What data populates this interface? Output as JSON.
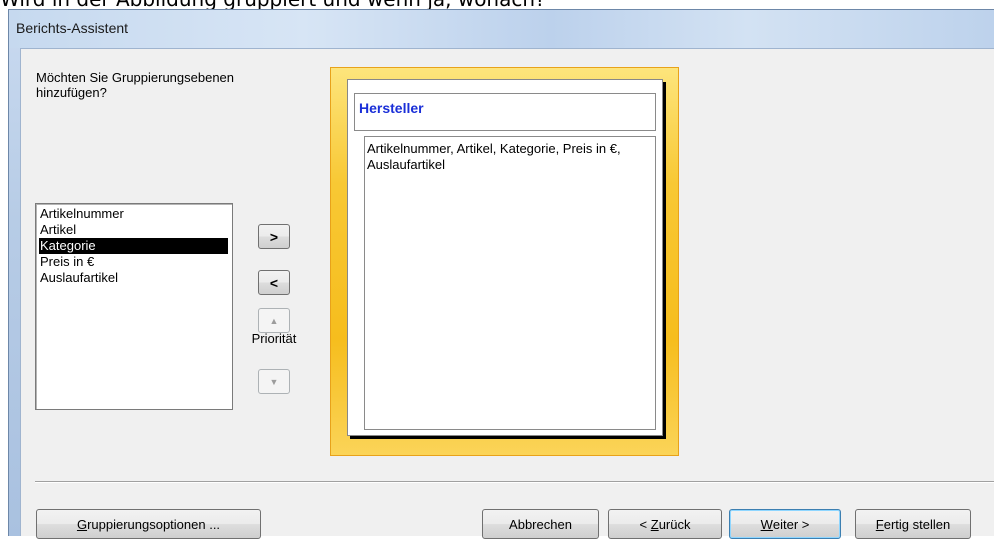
{
  "question": "Wird in der Abbildung gruppiert und wenn ja, wonach?",
  "window": {
    "title": "Berichts-Assistent"
  },
  "prompt": {
    "text": "Möchten Sie Gruppierungsebenen hinzufügen?"
  },
  "fields": {
    "items": [
      {
        "label": "Artikelnummer"
      },
      {
        "label": "Artikel"
      },
      {
        "label": "Kategorie"
      },
      {
        "label": "Preis in €"
      },
      {
        "label": "Auslaufartikel"
      }
    ],
    "selected_index": 2
  },
  "controls": {
    "add_label": ">",
    "remove_label": "<",
    "priority_up_label": "▲",
    "priority_down_label": "▼",
    "priority_label": "Priorität"
  },
  "preview": {
    "group_label": "Hersteller",
    "detail_text": "Artikelnummer, Artikel, Kategorie, Preis in €, Auslaufartikel"
  },
  "buttons": {
    "grouping_options": {
      "mnemonic": "G",
      "rest": "ruppierungsoptionen ..."
    },
    "cancel": {
      "label": "Abbrechen"
    },
    "back": {
      "prefix": "< ",
      "mnemonic": "Z",
      "rest": "urück"
    },
    "next": {
      "mnemonic": "W",
      "rest": "eiter >"
    },
    "finish": {
      "mnemonic": "F",
      "rest": "ertig stellen"
    }
  },
  "colors": {
    "group_label": "#1a2fd8",
    "selection_bg": "#000000",
    "preview_frame": "#f6bd1d"
  }
}
